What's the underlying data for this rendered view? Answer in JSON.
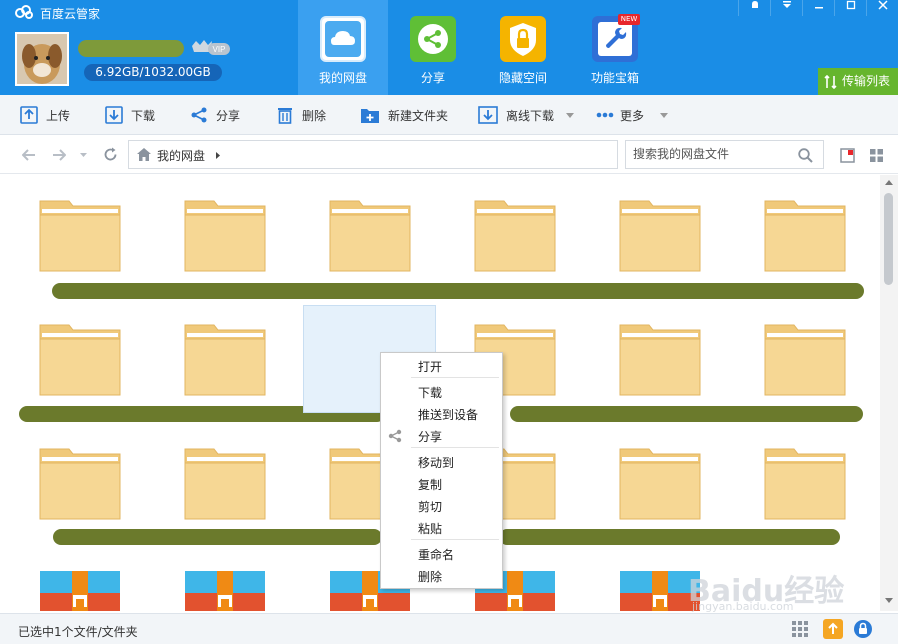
{
  "app": {
    "title": "百度云管家"
  },
  "user": {
    "quota": "6.92GB/1032.00GB",
    "vip_label": "VIP"
  },
  "nav": [
    {
      "label": "我的网盘",
      "icon": "cloud-icon"
    },
    {
      "label": "分享",
      "icon": "share-icon"
    },
    {
      "label": "隐藏空间",
      "icon": "lock-icon"
    },
    {
      "label": "功能宝箱",
      "icon": "wrench-icon",
      "badge": "NEW"
    }
  ],
  "transfer_label": "传输列表",
  "toolbar": {
    "upload": "上传",
    "download": "下载",
    "share": "分享",
    "delete": "删除",
    "new_folder": "新建文件夹",
    "offline_download": "离线下载",
    "more": "更多"
  },
  "path": {
    "root": "我的网盘"
  },
  "search": {
    "placeholder": "搜索我的网盘文件"
  },
  "context_menu": {
    "open": "打开",
    "download": "下载",
    "push_to_device": "推送到设备",
    "share": "分享",
    "move_to": "移动到",
    "copy": "复制",
    "cut": "剪切",
    "paste": "粘贴",
    "rename": "重命名",
    "delete": "删除"
  },
  "status": {
    "text": "已选中1个文件/文件夹"
  },
  "watermark": {
    "text": "Baidu经验",
    "url": "jingyan.baidu.com"
  },
  "colors": {
    "brand": "#1a8de6",
    "transfer_green": "#66b52e",
    "folder": "#f6d794"
  }
}
